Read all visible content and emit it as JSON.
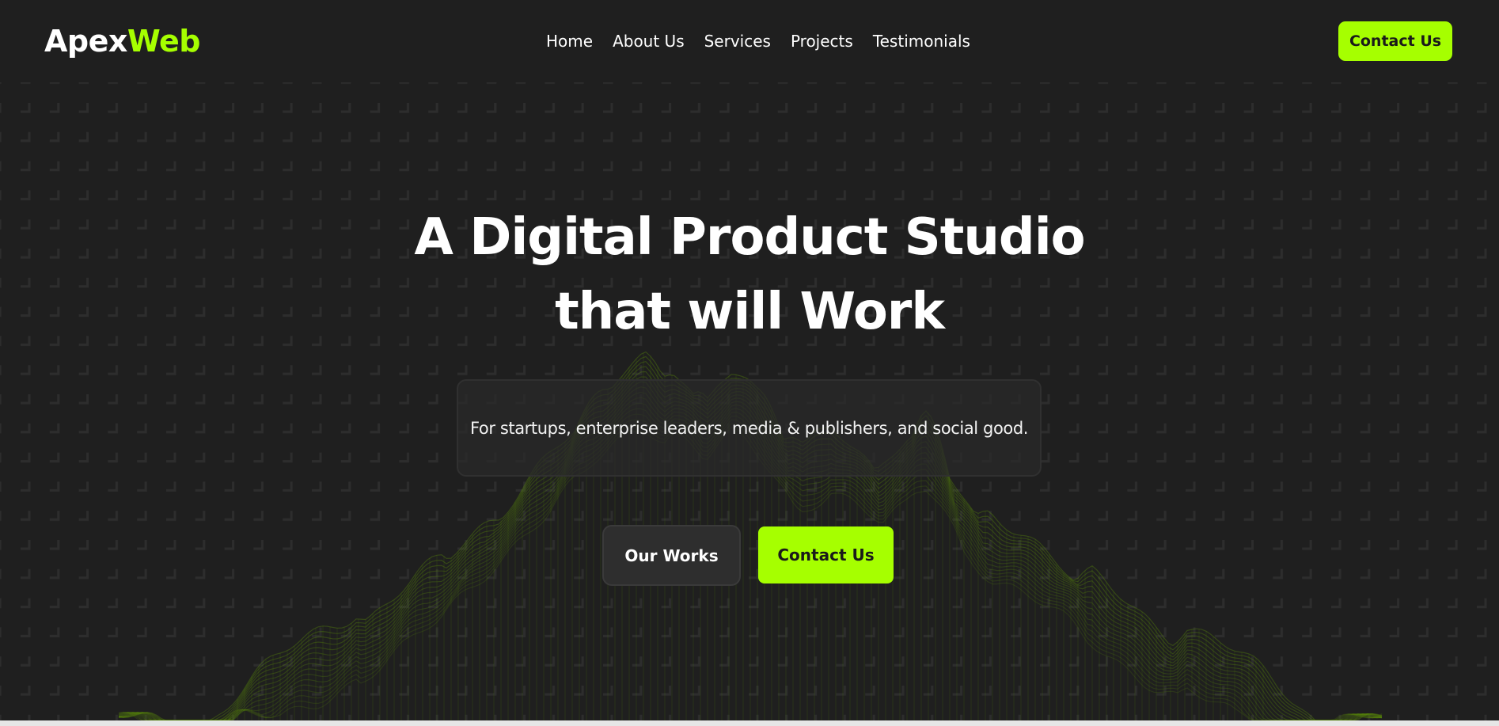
{
  "header": {
    "logo_primary": "Apex",
    "logo_accent": "Web",
    "nav": [
      {
        "label": "Home"
      },
      {
        "label": "About Us"
      },
      {
        "label": "Services"
      },
      {
        "label": "Projects"
      },
      {
        "label": "Testimonials"
      }
    ],
    "cta_label": "Contact Us"
  },
  "hero": {
    "title_line1": "A Digital Product Studio",
    "title_line2": "that will Work",
    "subtitle": "For startups, enterprise leaders, media & publishers, and social good.",
    "primary_button": "Our Works",
    "secondary_button": "Contact Us"
  },
  "colors": {
    "background": "#1f1f1f",
    "accent": "#a6ff00",
    "text": "#ffffff"
  },
  "icons": [
    "mountain-wireframe-graphic",
    "square-grid-pattern"
  ]
}
